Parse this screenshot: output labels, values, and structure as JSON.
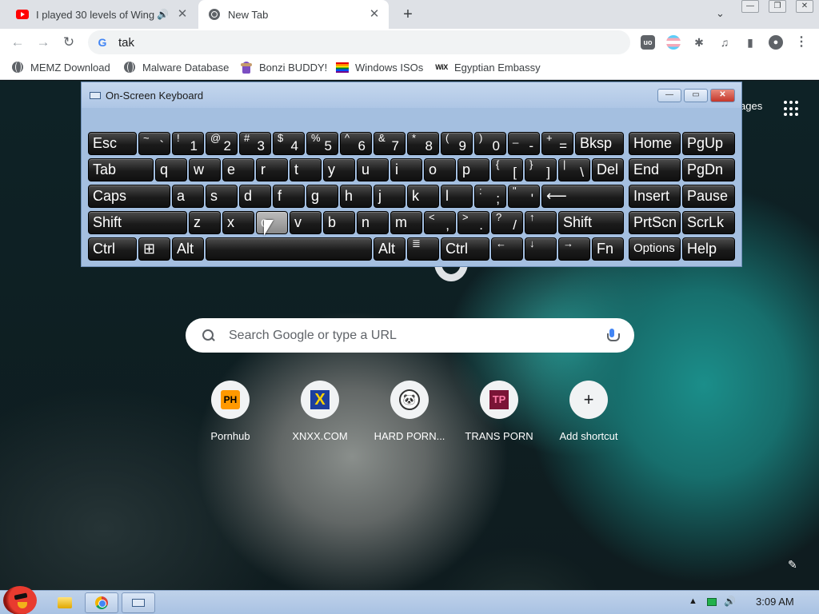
{
  "tabs": [
    {
      "title": "I played 30 levels of Wing",
      "favicon": "youtube-icon",
      "audio": "🔊",
      "close": "✕"
    },
    {
      "title": "New Tab",
      "favicon": "chrome-icon",
      "close": "✕"
    }
  ],
  "tabbar": {
    "new_tab": "+",
    "tab_search": "⌄"
  },
  "window_controls": {
    "minimize": "—",
    "maximize": "❐",
    "close": "✕"
  },
  "toolbar": {
    "back": "←",
    "forward": "→",
    "reload": "↻",
    "omnibox_value": "tak",
    "omnibox_icon": "G",
    "extensions": {
      "ublock": "uo",
      "puzzle": "✱",
      "media": "♫",
      "sidepanel": "▮",
      "profile": "●",
      "menu": "⋮"
    }
  },
  "bookmarks": [
    {
      "label": "MEMZ Download",
      "icon": "globe-icon"
    },
    {
      "label": "Malware Database",
      "icon": "globe-icon"
    },
    {
      "label": "Bonzi BUDDY!",
      "icon": "bonzi-icon"
    },
    {
      "label": "Windows ISOs",
      "icon": "rainbow-flag-icon"
    },
    {
      "label": "Egyptian Embassy",
      "icon": "wix-icon",
      "icon_text": "WiX"
    }
  ],
  "ntp": {
    "images_link": "ages",
    "search_placeholder": "Search Google or type a URL",
    "shortcuts": [
      {
        "label": "Pornhub",
        "icon_text": "PH"
      },
      {
        "label": "XNXX.COM",
        "icon_text": "X"
      },
      {
        "label": "HARD PORN...",
        "icon_text": "🐼"
      },
      {
        "label": "TRANS PORN",
        "icon_text": "TP"
      },
      {
        "label": "Add shortcut",
        "icon_text": "+"
      }
    ],
    "edit_icon": "✎"
  },
  "osk": {
    "title": "On-Screen Keyboard",
    "controls": {
      "minimize": "—",
      "restore": "▭",
      "close": "✕"
    },
    "keys": {
      "esc": "Esc",
      "tilde_s": "~",
      "tilde_b": "`",
      "k1s": "!",
      "k1b": "1",
      "k2s": "@",
      "k2b": "2",
      "k3s": "#",
      "k3b": "3",
      "k4s": "$",
      "k4b": "4",
      "k5s": "%",
      "k5b": "5",
      "k6s": "^",
      "k6b": "6",
      "k7s": "&",
      "k7b": "7",
      "k8s": "*",
      "k8b": "8",
      "k9s": "(",
      "k9b": "9",
      "k0s": ")",
      "k0b": "0",
      "minus_s": "_",
      "minus_b": "-",
      "plus_s": "+",
      "plus_b": "=",
      "bksp": "Bksp",
      "home": "Home",
      "pgup": "PgUp",
      "tab": "Tab",
      "q": "q",
      "w": "w",
      "e": "e",
      "r": "r",
      "t": "t",
      "y": "y",
      "u": "u",
      "i": "i",
      "o": "o",
      "p": "p",
      "lbr_s": "{",
      "lbr_b": "[",
      "rbr_s": "}",
      "rbr_b": "]",
      "bs_s": "|",
      "bs_b": "\\",
      "del": "Del",
      "end": "End",
      "pgdn": "PgDn",
      "caps": "Caps",
      "a": "a",
      "s": "s",
      "d": "d",
      "f": "f",
      "g": "g",
      "h": "h",
      "j": "j",
      "k": "k",
      "l": "l",
      "semi_s": ":",
      "semi_b": ";",
      "quote_s": "\"",
      "quote_b": "'",
      "enter": "⟵",
      "insert": "Insert",
      "pause": "Pause",
      "lshift": "Shift",
      "z": "z",
      "x": "x",
      "c": "c",
      "v": "v",
      "b": "b",
      "n": "n",
      "m": "m",
      "comma_s": "<",
      "comma_b": ",",
      "period_s": ">",
      "period_b": ".",
      "slash_s": "?",
      "slash_b": "/",
      "up": "↑",
      "rshift": "Shift",
      "prtscn": "PrtScn",
      "scrlk": "ScrLk",
      "lctrl": "Ctrl",
      "win": "⊞",
      "lalt": "Alt",
      "space": "",
      "ralt": "Alt",
      "menu": "≣",
      "rctrl": "Ctrl",
      "left": "←",
      "down": "↓",
      "right": "→",
      "fn": "Fn",
      "options": "Options",
      "help": "Help"
    }
  },
  "taskbar": {
    "tray_up": "▲",
    "volume": "🔊",
    "clock": "3:09 AM"
  }
}
